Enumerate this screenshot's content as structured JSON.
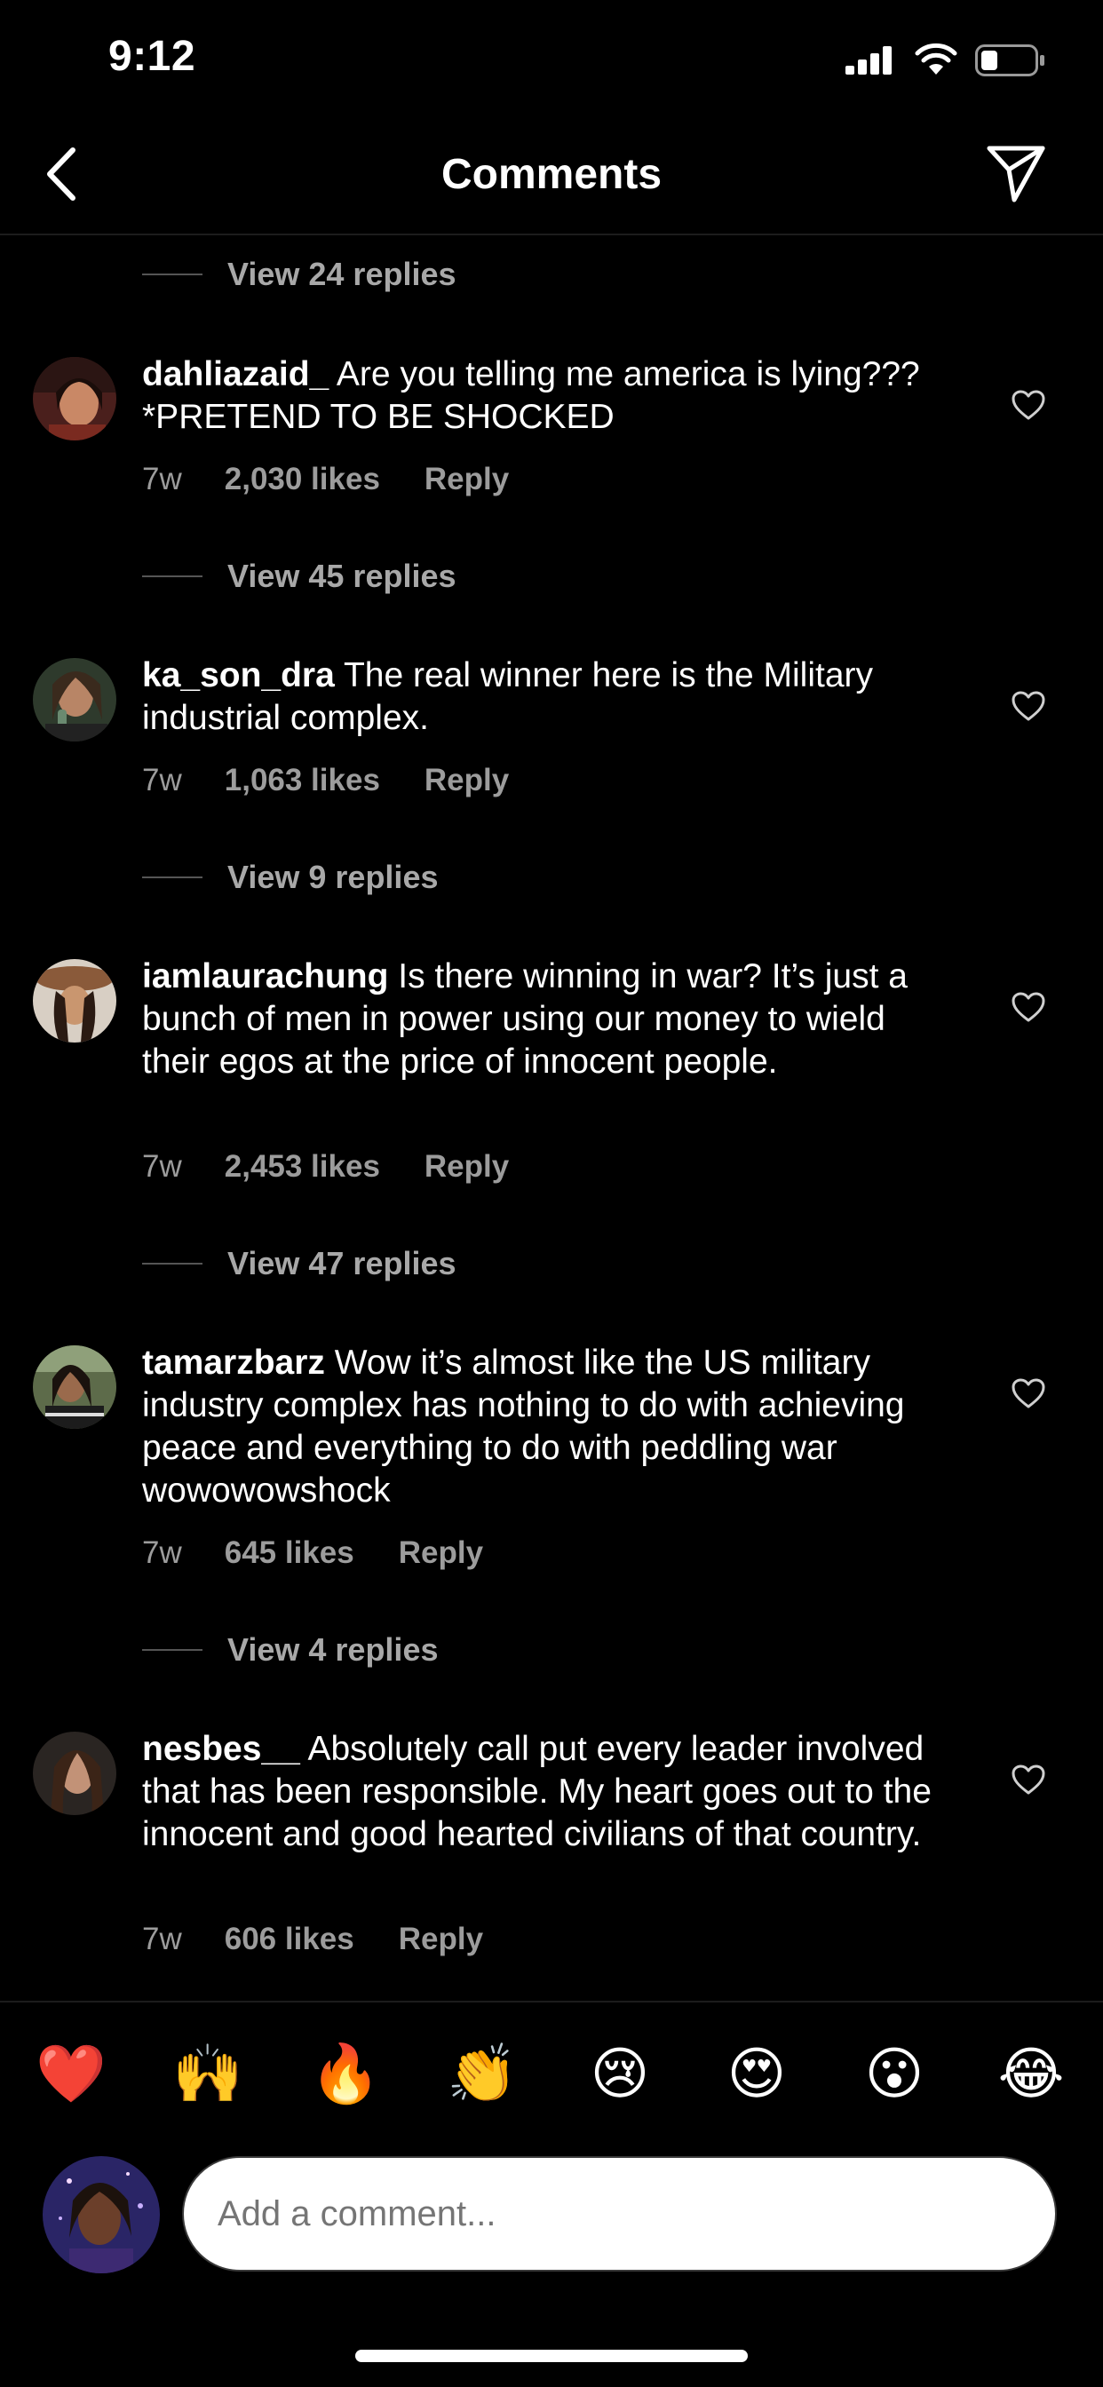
{
  "status": {
    "time": "9:12"
  },
  "nav": {
    "title": "Comments",
    "back_icon": "chevron-left-icon",
    "send_icon": "paper-plane-icon"
  },
  "top_view_replies": "View 24 replies",
  "comments": [
    {
      "username": "dahliazaid_",
      "text": "Are you telling me america is lying??? *PRETEND TO BE SHOCKED",
      "age": "7w",
      "likes": "2,030 likes",
      "reply": "Reply",
      "view_replies": "View 45 replies"
    },
    {
      "username": "ka_son_dra",
      "text": "The real winner here is the Military industrial complex.",
      "age": "7w",
      "likes": "1,063 likes",
      "reply": "Reply",
      "view_replies": "View 9 replies"
    },
    {
      "username": "iamlaurachung",
      "text": "Is there winning in war? It’s just a bunch of men in power using our money to wield their egos at the price of innocent people.",
      "age": "7w",
      "likes": "2,453 likes",
      "reply": "Reply",
      "view_replies": "View 47 replies"
    },
    {
      "username": "tamarzbarz",
      "text": "Wow it’s almost like the US military industry complex has nothing to do with achieving peace and everything to do with peddling war  wowowowshock",
      "age": "7w",
      "likes": "645 likes",
      "reply": "Reply",
      "view_replies": "View 4 replies"
    },
    {
      "username": "nesbes__",
      "text": "Absolutely call put every leader involved that has been responsible. My heart goes out to the innocent and good hearted civilians of that country.",
      "age": "7w",
      "likes": "606 likes",
      "reply": "Reply"
    }
  ],
  "emoji_bar": [
    "❤️",
    "🙌",
    "🔥",
    "👏",
    "😢",
    "😍",
    "😮",
    "😂"
  ],
  "compose": {
    "placeholder": "Add a comment..."
  },
  "colors": {
    "background": "#000000",
    "secondary_text": "#a8a8a8",
    "border": "#3a3a3a"
  }
}
